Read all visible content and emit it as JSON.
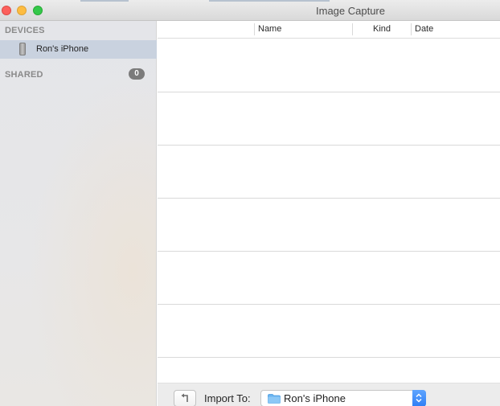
{
  "window": {
    "title": "Image Capture",
    "controls": [
      "close",
      "minimize",
      "zoom"
    ]
  },
  "sidebar": {
    "devices_header": "DEVICES",
    "devices": [
      {
        "label": "Ron's iPhone",
        "icon": "iphone-icon",
        "selected": true
      }
    ],
    "shared_header": "SHARED",
    "shared_count": "0"
  },
  "list": {
    "columns": [
      "Name",
      "Kind",
      "Date"
    ],
    "rows": []
  },
  "bottom_bar": {
    "rotate_icon": "rotate-left-icon",
    "import_label": "Import To:",
    "import_destination": "Ron's iPhone",
    "destination_icon": "folder-icon"
  },
  "colors": {
    "sidebar_selection": "#c9d2df",
    "close": "#fc605c",
    "minimize": "#fdbc40",
    "zoom": "#34c84a",
    "stepper_accent": "#2f7ef5"
  }
}
